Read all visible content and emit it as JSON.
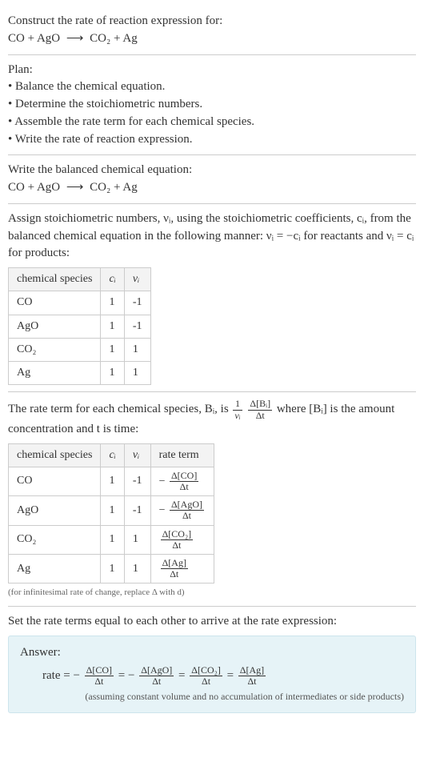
{
  "intro": {
    "title": "Construct the rate of reaction expression for:",
    "eq_lhs": "CO + AgO",
    "eq_rhs": "CO₂ + Ag",
    "arrow": "⟶"
  },
  "plan": {
    "heading": "Plan:",
    "items": [
      "Balance the chemical equation.",
      "Determine the stoichiometric numbers.",
      "Assemble the rate term for each chemical species.",
      "Write the rate of reaction expression."
    ]
  },
  "balanced": {
    "heading": "Write the balanced chemical equation:",
    "eq_lhs": "CO + AgO",
    "eq_rhs": "CO₂ + Ag",
    "arrow": "⟶"
  },
  "stoich": {
    "intro": "Assign stoichiometric numbers, νᵢ, using the stoichiometric coefficients, cᵢ, from the balanced chemical equation in the following manner: νᵢ = −cᵢ for reactants and νᵢ = cᵢ for products:",
    "headers": {
      "species": "chemical species",
      "ci": "cᵢ",
      "vi": "νᵢ"
    },
    "rows": [
      {
        "species": "CO",
        "ci": "1",
        "vi": "-1"
      },
      {
        "species": "AgO",
        "ci": "1",
        "vi": "-1"
      },
      {
        "species": "CO₂",
        "ci": "1",
        "vi": "1"
      },
      {
        "species": "Ag",
        "ci": "1",
        "vi": "1"
      }
    ]
  },
  "rateterm": {
    "intro_pre": "The rate term for each chemical species, Bᵢ, is ",
    "intro_post": " where [Bᵢ] is the amount concentration and t is time:",
    "frac1_num": "1",
    "frac1_den": "νᵢ",
    "frac2_num": "Δ[Bᵢ]",
    "frac2_den": "Δt",
    "headers": {
      "species": "chemical species",
      "ci": "cᵢ",
      "vi": "νᵢ",
      "rate": "rate term"
    },
    "rows": [
      {
        "species": "CO",
        "ci": "1",
        "vi": "-1",
        "sign": "−",
        "num": "Δ[CO]",
        "den": "Δt"
      },
      {
        "species": "AgO",
        "ci": "1",
        "vi": "-1",
        "sign": "−",
        "num": "Δ[AgO]",
        "den": "Δt"
      },
      {
        "species": "CO₂",
        "ci": "1",
        "vi": "1",
        "sign": "",
        "num": "Δ[CO₂]",
        "den": "Δt"
      },
      {
        "species": "Ag",
        "ci": "1",
        "vi": "1",
        "sign": "",
        "num": "Δ[Ag]",
        "den": "Δt"
      }
    ],
    "note": "(for infinitesimal rate of change, replace Δ with d)"
  },
  "final": {
    "heading": "Set the rate terms equal to each other to arrive at the rate expression:",
    "answer_label": "Answer:",
    "rate_label": "rate = ",
    "terms": [
      {
        "sign": "−",
        "num": "Δ[CO]",
        "den": "Δt"
      },
      {
        "sign": "−",
        "num": "Δ[AgO]",
        "den": "Δt"
      },
      {
        "sign": "",
        "num": "Δ[CO₂]",
        "den": "Δt"
      },
      {
        "sign": "",
        "num": "Δ[Ag]",
        "den": "Δt"
      }
    ],
    "eq_sep": " = ",
    "assumption": "(assuming constant volume and no accumulation of intermediates or side products)"
  },
  "chart_data": {
    "type": "table",
    "title": "Stoichiometric numbers and rate terms",
    "tables": [
      {
        "columns": [
          "chemical species",
          "c_i",
          "ν_i"
        ],
        "rows": [
          [
            "CO",
            1,
            -1
          ],
          [
            "AgO",
            1,
            -1
          ],
          [
            "CO₂",
            1,
            1
          ],
          [
            "Ag",
            1,
            1
          ]
        ]
      },
      {
        "columns": [
          "chemical species",
          "c_i",
          "ν_i",
          "rate term"
        ],
        "rows": [
          [
            "CO",
            1,
            -1,
            "-Δ[CO]/Δt"
          ],
          [
            "AgO",
            1,
            -1,
            "-Δ[AgO]/Δt"
          ],
          [
            "CO₂",
            1,
            1,
            "Δ[CO₂]/Δt"
          ],
          [
            "Ag",
            1,
            1,
            "Δ[Ag]/Δt"
          ]
        ]
      }
    ],
    "rate_expression": "rate = -Δ[CO]/Δt = -Δ[AgO]/Δt = Δ[CO₂]/Δt = Δ[Ag]/Δt"
  }
}
